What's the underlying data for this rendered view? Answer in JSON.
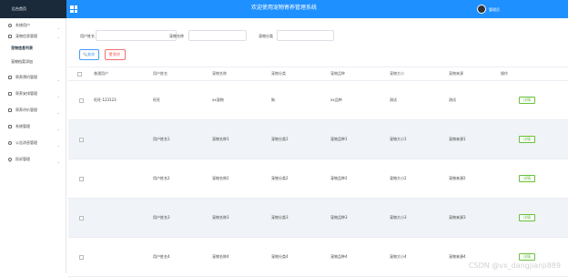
{
  "header": {
    "brand": "后台首页",
    "title": "欢迎使用宠物寄养管理系统",
    "user": "管理员"
  },
  "sidebar": {
    "items": [
      {
        "label": "系统用户"
      },
      {
        "label": "宠物信息管理"
      },
      {
        "label": "寄养预约管理"
      },
      {
        "label": "寄养安排管理"
      },
      {
        "label": "寄养评价管理"
      },
      {
        "label": "系统管理"
      },
      {
        "label": "公告消息管理"
      },
      {
        "label": "投诉管理"
      }
    ],
    "submenu": [
      {
        "label": "宠物信息列表"
      },
      {
        "label": "宠物档案添加"
      }
    ]
  },
  "search": {
    "user_label": "用户姓名",
    "name_label": "宠物名称",
    "category_label": "宠物分类",
    "search_button": "查询",
    "delete_button": "删除"
  },
  "table": {
    "headers": [
      "普通用户",
      "用户姓名",
      "宠物名称",
      "宠物分类",
      "宠物品种",
      "宠物大小",
      "宠物来源",
      "操作"
    ],
    "rows": [
      [
        "旺旺-123123",
        "旺旺",
        "xx宠物",
        "狗",
        "xx品种",
        "测试",
        "测试"
      ],
      [
        "",
        "用户姓名1",
        "宠物名称1",
        "宠物分类1",
        "宠物品种1",
        "宠物大小1",
        "宠物来源1"
      ],
      [
        "",
        "用户姓名2",
        "宠物名称2",
        "宠物分类2",
        "宠物品种2",
        "宠物大小2",
        "宠物来源2"
      ],
      [
        "",
        "用户姓名3",
        "宠物名称3",
        "宠物分类3",
        "宠物品种3",
        "宠物大小3",
        "宠物来源3"
      ],
      [
        "",
        "用户姓名4",
        "宠物名称4",
        "宠物分类4",
        "宠物品种4",
        "宠物大小4",
        "宠物来源4"
      ]
    ],
    "detail_label": "详情"
  },
  "watermark": "CSDN @vx_dangjianji889"
}
